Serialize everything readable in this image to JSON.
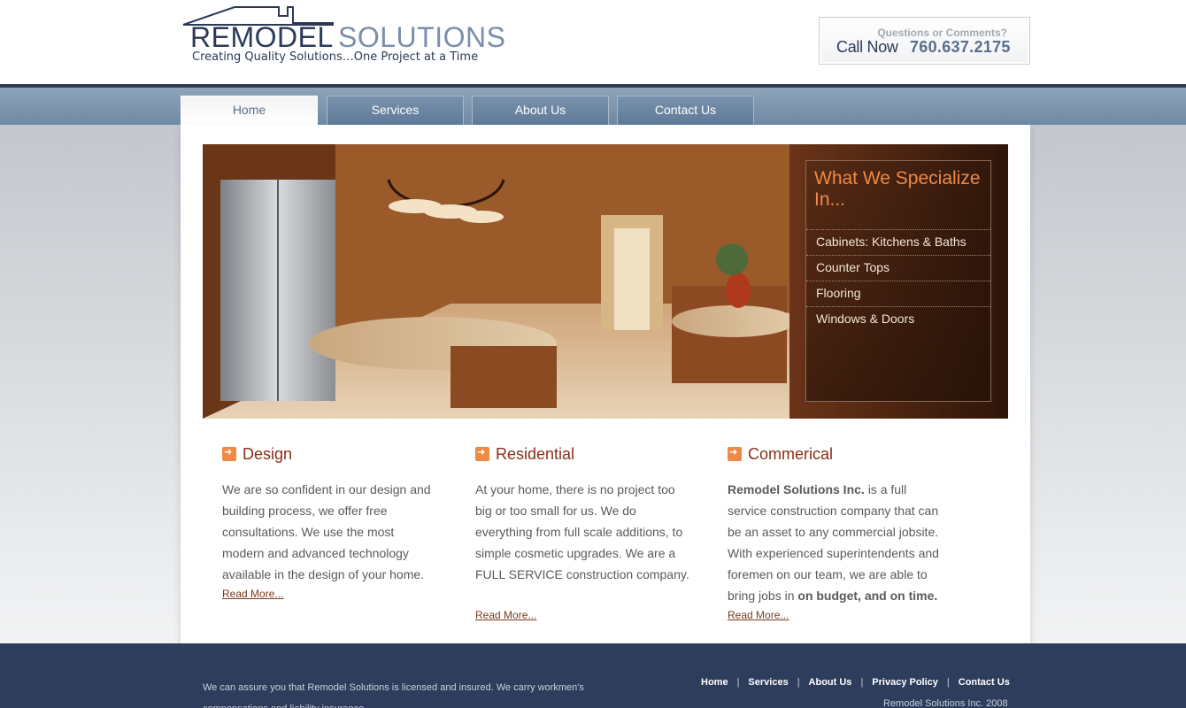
{
  "brand": {
    "word1": "REMODEL",
    "word2": "SOLUTIONS",
    "tagline": "Creating Quality Solutions…One Project at a Time"
  },
  "callbox": {
    "question": "Questions or Comments?",
    "call_label": "Call Now",
    "phone": "760.637.2175"
  },
  "nav": {
    "tabs": [
      {
        "label": "Home",
        "active": true
      },
      {
        "label": "Services"
      },
      {
        "label": "About Us"
      },
      {
        "label": "Contact Us"
      }
    ]
  },
  "hero": {
    "title": "What We Specialize In...",
    "items": [
      "Cabinets: Kitchens & Baths",
      "Counter Tops",
      "Flooring",
      "Windows & Doors"
    ]
  },
  "columns": [
    {
      "heading": "Design",
      "body": "We are so confident in our design and building process, we offer free consultations. We use the most modern and advanced technology available in the design of your home.",
      "link": "Read More..."
    },
    {
      "heading": "Residential",
      "body": "At your home, there is no project too big or too small for us. We do everything from full scale additions, to simple cosmetic upgrades. We are a FULL SERVICE construction company.",
      "link": "Read More..."
    },
    {
      "heading": "Commerical",
      "body_bold_lead": "Remodel Solutions Inc.",
      "body_mid": "is a full service construction company that can be an asset to any commercial jobsite. With experienced superintendents and foremen on our team, we are able to bring jobs in",
      "body_bold_tail": "on budget, and on time.",
      "link": "Read More..."
    }
  ],
  "footer": {
    "text": "We can assure you that Remodel Solutions is licensed and insured. We carry workmen's compensations and liability insurance.",
    "links": [
      "Home",
      "Services",
      "About Us",
      "Privacy Policy",
      "Contact Us"
    ],
    "copyright": "Remodel Solutions Inc. 2008"
  },
  "colors": {
    "navy": "#2b3a57",
    "accent": "#ef8a44",
    "heading": "#8a2d18"
  }
}
